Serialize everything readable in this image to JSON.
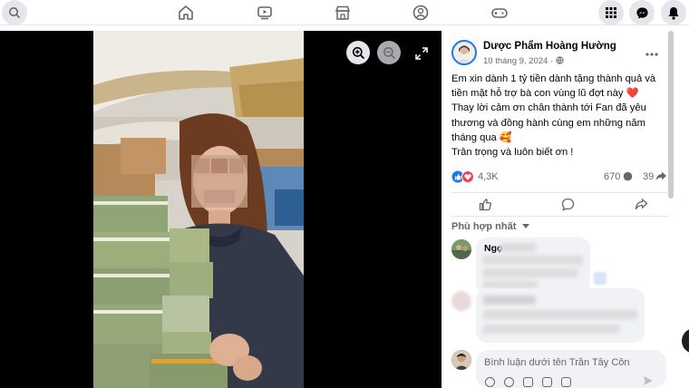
{
  "nav": {
    "search_icon": "search-icon",
    "center_icons": [
      "home-icon",
      "watch-icon",
      "marketplace-icon",
      "groups-icon",
      "gaming-icon"
    ],
    "right_icons": [
      "menu-grid-icon",
      "messenger-icon",
      "notifications-icon"
    ]
  },
  "media": {
    "zoom_in_icon": "zoom-in-icon",
    "zoom_out_icon": "zoom-out-icon",
    "fullscreen_icon": "fullscreen-icon"
  },
  "post": {
    "author": "Dược Phẩm Hoàng Hường",
    "date": "10 tháng 9, 2024 ·",
    "privacy_icon": "globe-icon",
    "more_icon": "more-icon",
    "text_lines": [
      "Em xin dành 1 tỷ tiền dành tặng thành quả và",
      "tiền mặt hỗ trợ bà con vùng lũ đợt này ❤️",
      "Thay lời cảm ơn chân thành tới Fan đã yêu",
      "thương và đồng hành cùng em những năm",
      "tháng qua 🥰",
      "Trân trọng và luôn biết ơn !"
    ],
    "reaction_count": "4,3K",
    "comment_count": "670",
    "share_count": "39",
    "like_icon": "like-icon",
    "comment_icon": "comment-icon",
    "share_icon": "share-icon"
  },
  "comments": {
    "sort_label": "Phù hợp nhất",
    "first_commenter": "Ngọ",
    "composer_placeholder": "Bình luận dưới tên Trần Tây Côn"
  },
  "colors": {
    "accent": "#1877f2",
    "love": "#f33e58",
    "text": "#050505",
    "muted": "#65676b"
  }
}
